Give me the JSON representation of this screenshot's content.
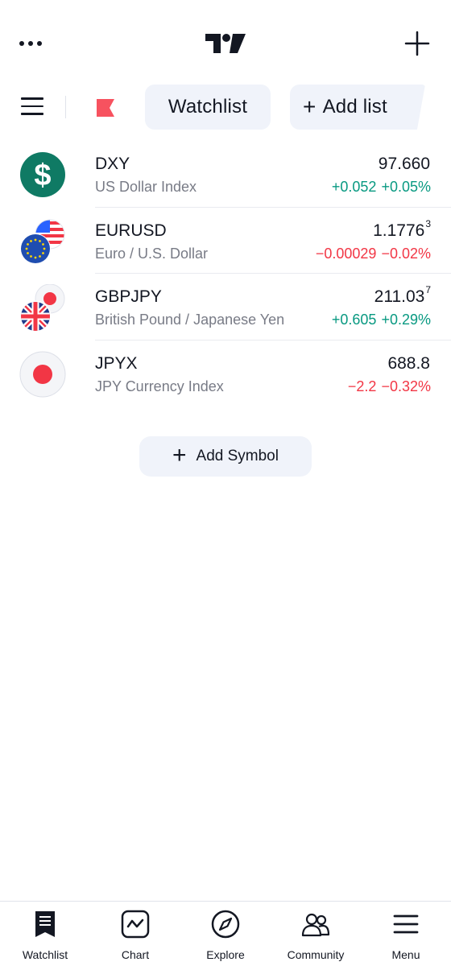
{
  "header": {
    "more_icon": "more-horizontal-icon",
    "logo_icon": "tradingview-logo",
    "add_icon": "plus-icon"
  },
  "toolbar": {
    "menu_icon": "hamburger-icon",
    "flag_icon": "flag-icon",
    "flag_color": "#f7525f",
    "watchlist_label": "Watchlist",
    "add_list_plus": "+",
    "add_list_label": "Add list"
  },
  "watchlist": [
    {
      "symbol": "DXY",
      "description": "US Dollar Index",
      "price": "97.660",
      "price_sup": "",
      "change": "+0.052",
      "change_pct": "+0.05%",
      "direction": "up",
      "icon": "dollar-icon"
    },
    {
      "symbol": "EURUSD",
      "description": "Euro / U.S. Dollar",
      "price": "1.1776",
      "price_sup": "3",
      "change": "−0.00029",
      "change_pct": "−0.02%",
      "direction": "down",
      "icon": "eu-us-flags-icon"
    },
    {
      "symbol": "GBPJPY",
      "description": "British Pound / Japanese Yen",
      "price": "211.03",
      "price_sup": "7",
      "change": "+0.605",
      "change_pct": "+0.29%",
      "direction": "up",
      "icon": "uk-jp-flags-icon"
    },
    {
      "symbol": "JPYX",
      "description": "JPY Currency Index",
      "price": "688.8",
      "price_sup": "",
      "change": "−2.2",
      "change_pct": "−0.32%",
      "direction": "down",
      "icon": "jp-flag-icon"
    }
  ],
  "add_symbol": {
    "plus": "+",
    "label": "Add Symbol"
  },
  "nav": [
    {
      "label": "Watchlist",
      "icon": "watchlist-icon",
      "active": true
    },
    {
      "label": "Chart",
      "icon": "chart-icon",
      "active": false
    },
    {
      "label": "Explore",
      "icon": "compass-icon",
      "active": false
    },
    {
      "label": "Community",
      "icon": "community-icon",
      "active": false
    },
    {
      "label": "Menu",
      "icon": "menu-icon",
      "active": false
    }
  ],
  "colors": {
    "up": "#089981",
    "down": "#f23645",
    "text": "#131722",
    "muted": "#787b86",
    "pill_bg": "#f0f3fa",
    "dollar_green": "#0f7a64"
  }
}
